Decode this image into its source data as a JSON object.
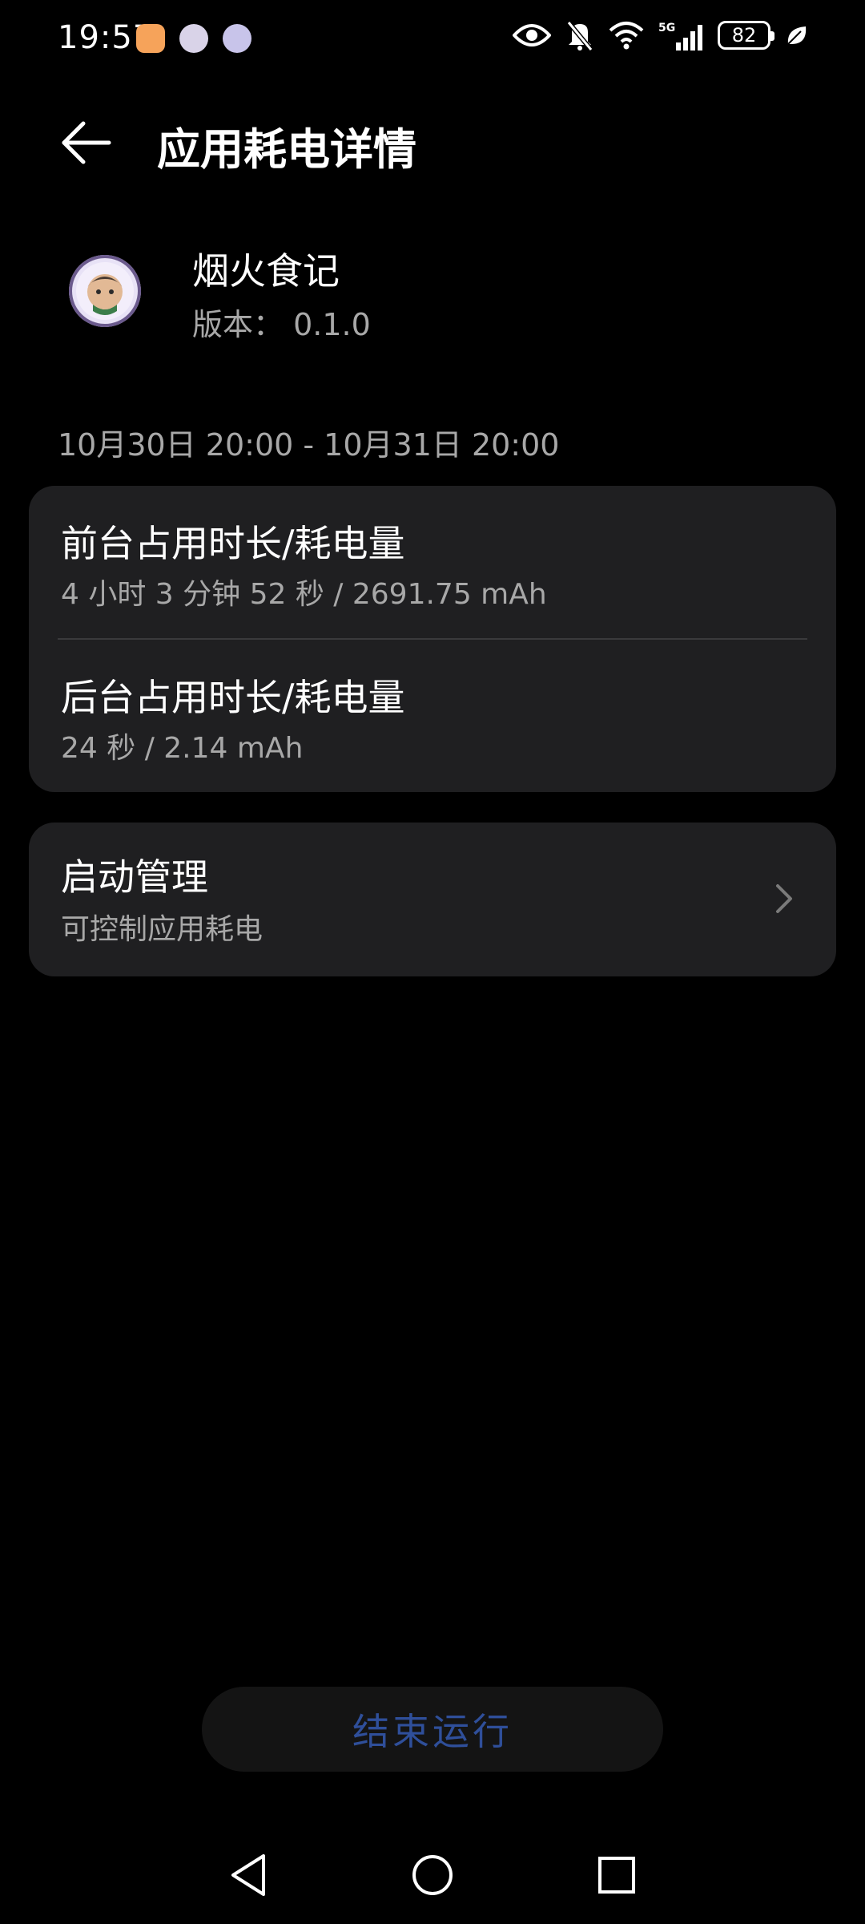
{
  "status_bar": {
    "time": "19:57",
    "battery": "82",
    "network": "5G"
  },
  "header": {
    "title": "应用耗电详情"
  },
  "app": {
    "name": "烟火食记",
    "version": "版本： 0.1.0"
  },
  "date_range": "10月30日 20:00 - 10月31日 20:00",
  "usage": {
    "foreground": {
      "title": "前台占用时长/耗电量",
      "detail": "4 小时 3 分钟 52 秒 / 2691.75 mAh"
    },
    "background": {
      "title": "后台占用时长/耗电量",
      "detail": "24 秒 / 2.14 mAh"
    }
  },
  "startup": {
    "title": "启动管理",
    "subtitle": "可控制应用耗电"
  },
  "end_button": {
    "label": "结束运行"
  },
  "colors": {
    "background": "#000000",
    "card": "#1f1f21",
    "secondary_text": "#a8a8a8",
    "end_button_text": "#2f4f9a"
  }
}
